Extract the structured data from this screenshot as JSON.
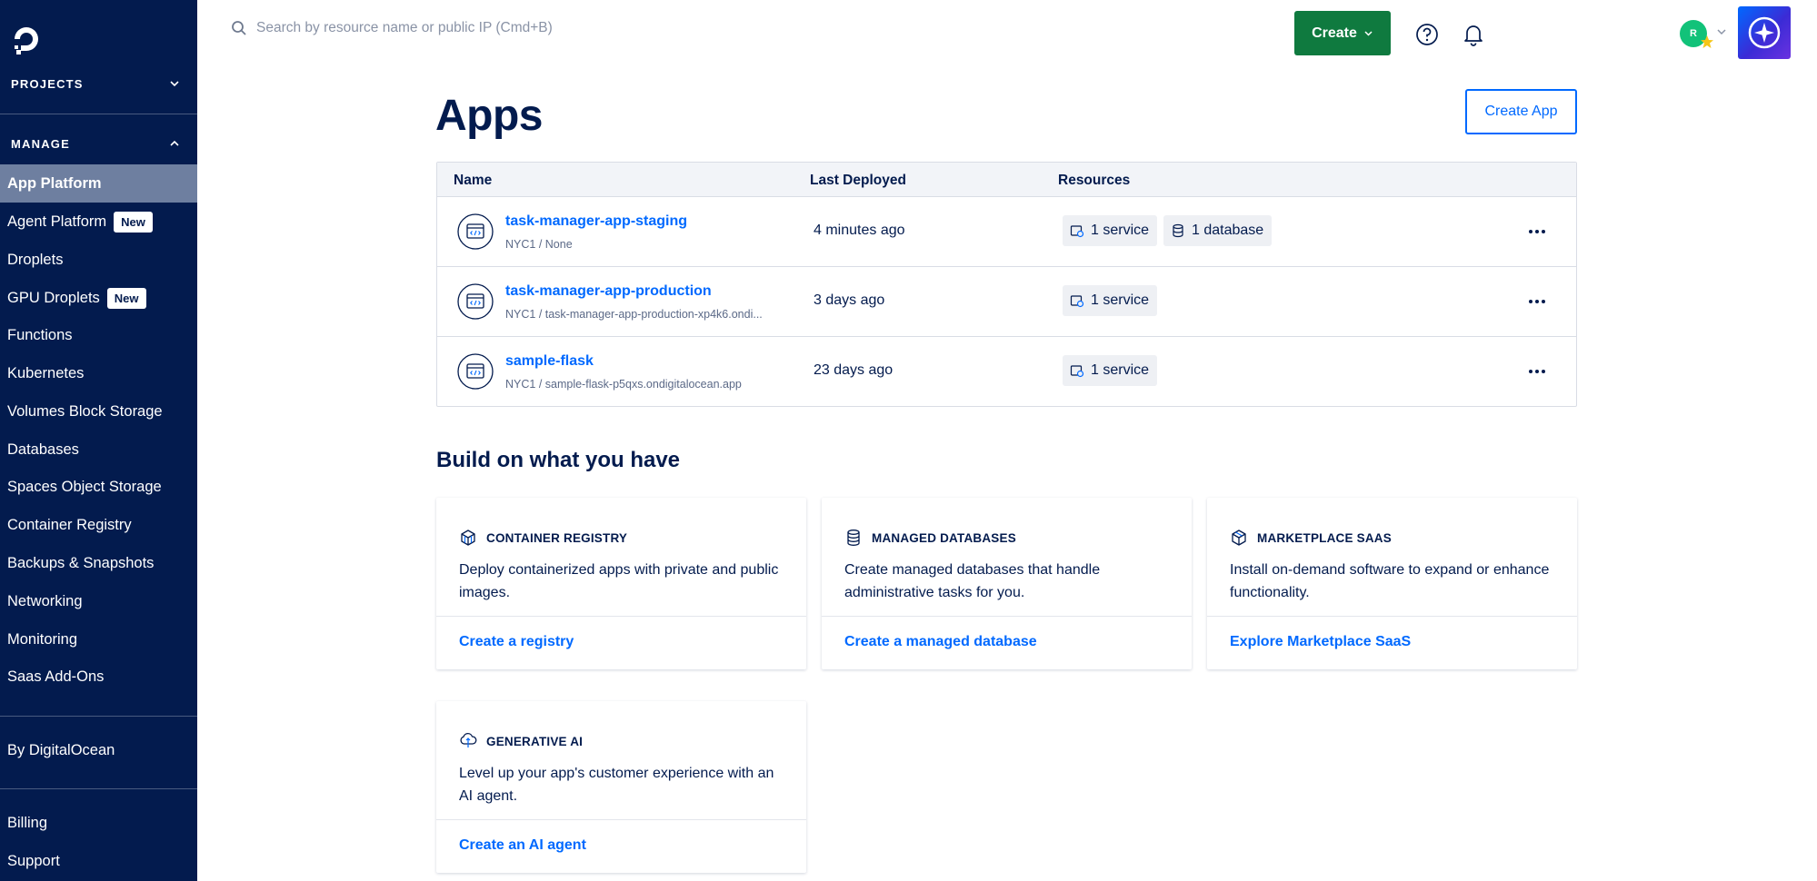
{
  "sidebar": {
    "projects_label": "PROJECTS",
    "manage_label": "MANAGE",
    "items": [
      {
        "label": "App Platform"
      },
      {
        "label": "Agent Platform",
        "badge": "New"
      },
      {
        "label": "Droplets"
      },
      {
        "label": "GPU Droplets",
        "badge": "New"
      },
      {
        "label": "Functions"
      },
      {
        "label": "Kubernetes"
      },
      {
        "label": "Volumes Block Storage"
      },
      {
        "label": "Databases"
      },
      {
        "label": "Spaces Object Storage"
      },
      {
        "label": "Container Registry"
      },
      {
        "label": "Backups & Snapshots"
      },
      {
        "label": "Networking"
      },
      {
        "label": "Monitoring"
      },
      {
        "label": "Saas Add-Ons"
      }
    ],
    "by_label": "By DigitalOcean",
    "billing_label": "Billing",
    "support_label": "Support"
  },
  "header": {
    "search_placeholder": "Search by resource name or public IP (Cmd+B)",
    "create_label": "Create",
    "avatar_initial": "R"
  },
  "main": {
    "title": "Apps",
    "create_app_label": "Create App",
    "table": {
      "columns": [
        "Name",
        "Last Deployed",
        "Resources"
      ],
      "rows": [
        {
          "name": "task-manager-app-staging",
          "sub": "NYC1 / None",
          "deployed": "4 minutes ago",
          "resources": [
            "1 service",
            "1 database"
          ]
        },
        {
          "name": "task-manager-app-production",
          "sub": "NYC1 / task-manager-app-production-xp4k6.ondi...",
          "deployed": "3 days ago",
          "resources": [
            "1 service"
          ]
        },
        {
          "name": "sample-flask",
          "sub": "NYC1 / sample-flask-p5qxs.ondigitalocean.app",
          "deployed": "23 days ago",
          "resources": [
            "1 service"
          ]
        }
      ]
    },
    "build_title": "Build on what you have",
    "cards": [
      {
        "title": "CONTAINER REGISTRY",
        "desc": "Deploy containerized apps with private and public images.",
        "link": "Create a registry",
        "icon": "container-registry-icon"
      },
      {
        "title": "MANAGED DATABASES",
        "desc": "Create managed databases that handle administrative tasks for you.",
        "link": "Create a managed database",
        "icon": "database-icon"
      },
      {
        "title": "MARKETPLACE SAAS",
        "desc": "Install on-demand software to expand or enhance functionality.",
        "link": "Explore Marketplace SaaS",
        "icon": "marketplace-icon"
      },
      {
        "title": "GENERATIVE AI",
        "desc": "Level up your app's customer experience with an AI agent.",
        "link": "Create an AI agent",
        "icon": "ai-cloud-icon"
      }
    ]
  },
  "colors": {
    "sidebar_bg": "#031b4e",
    "active_item_bg": "#6e7fa0",
    "link_blue": "#0069ff",
    "create_green": "#0f7a3f"
  }
}
